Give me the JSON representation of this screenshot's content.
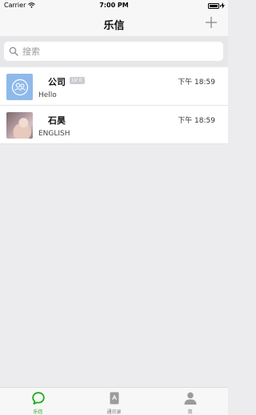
{
  "status_bar": {
    "carrier": "Carrier",
    "time": "7:00 PM"
  },
  "nav": {
    "title": "乐信",
    "add_icon": "plus-icon"
  },
  "search": {
    "placeholder": "搜索",
    "icon": "search-icon"
  },
  "chats": [
    {
      "name": "公司",
      "tag": "LV 0",
      "preview": "Hello",
      "time": "下午 18:59",
      "avatar": "group-avatar",
      "avatar_color": "#8fb9ea"
    },
    {
      "name": "石昊",
      "preview": "ENGLISH",
      "time": "下午 18:59",
      "avatar": "photo-avatar"
    }
  ],
  "tabs": [
    {
      "label": "乐信",
      "icon": "chat-bubble-icon",
      "active": true
    },
    {
      "label": "通讯录",
      "icon": "contacts-book-icon",
      "active": false
    },
    {
      "label": "我",
      "icon": "person-icon",
      "active": false
    }
  ],
  "colors": {
    "accent_green": "#1aad19",
    "background": "#ececee",
    "inactive_tab": "#9b9b9b"
  }
}
